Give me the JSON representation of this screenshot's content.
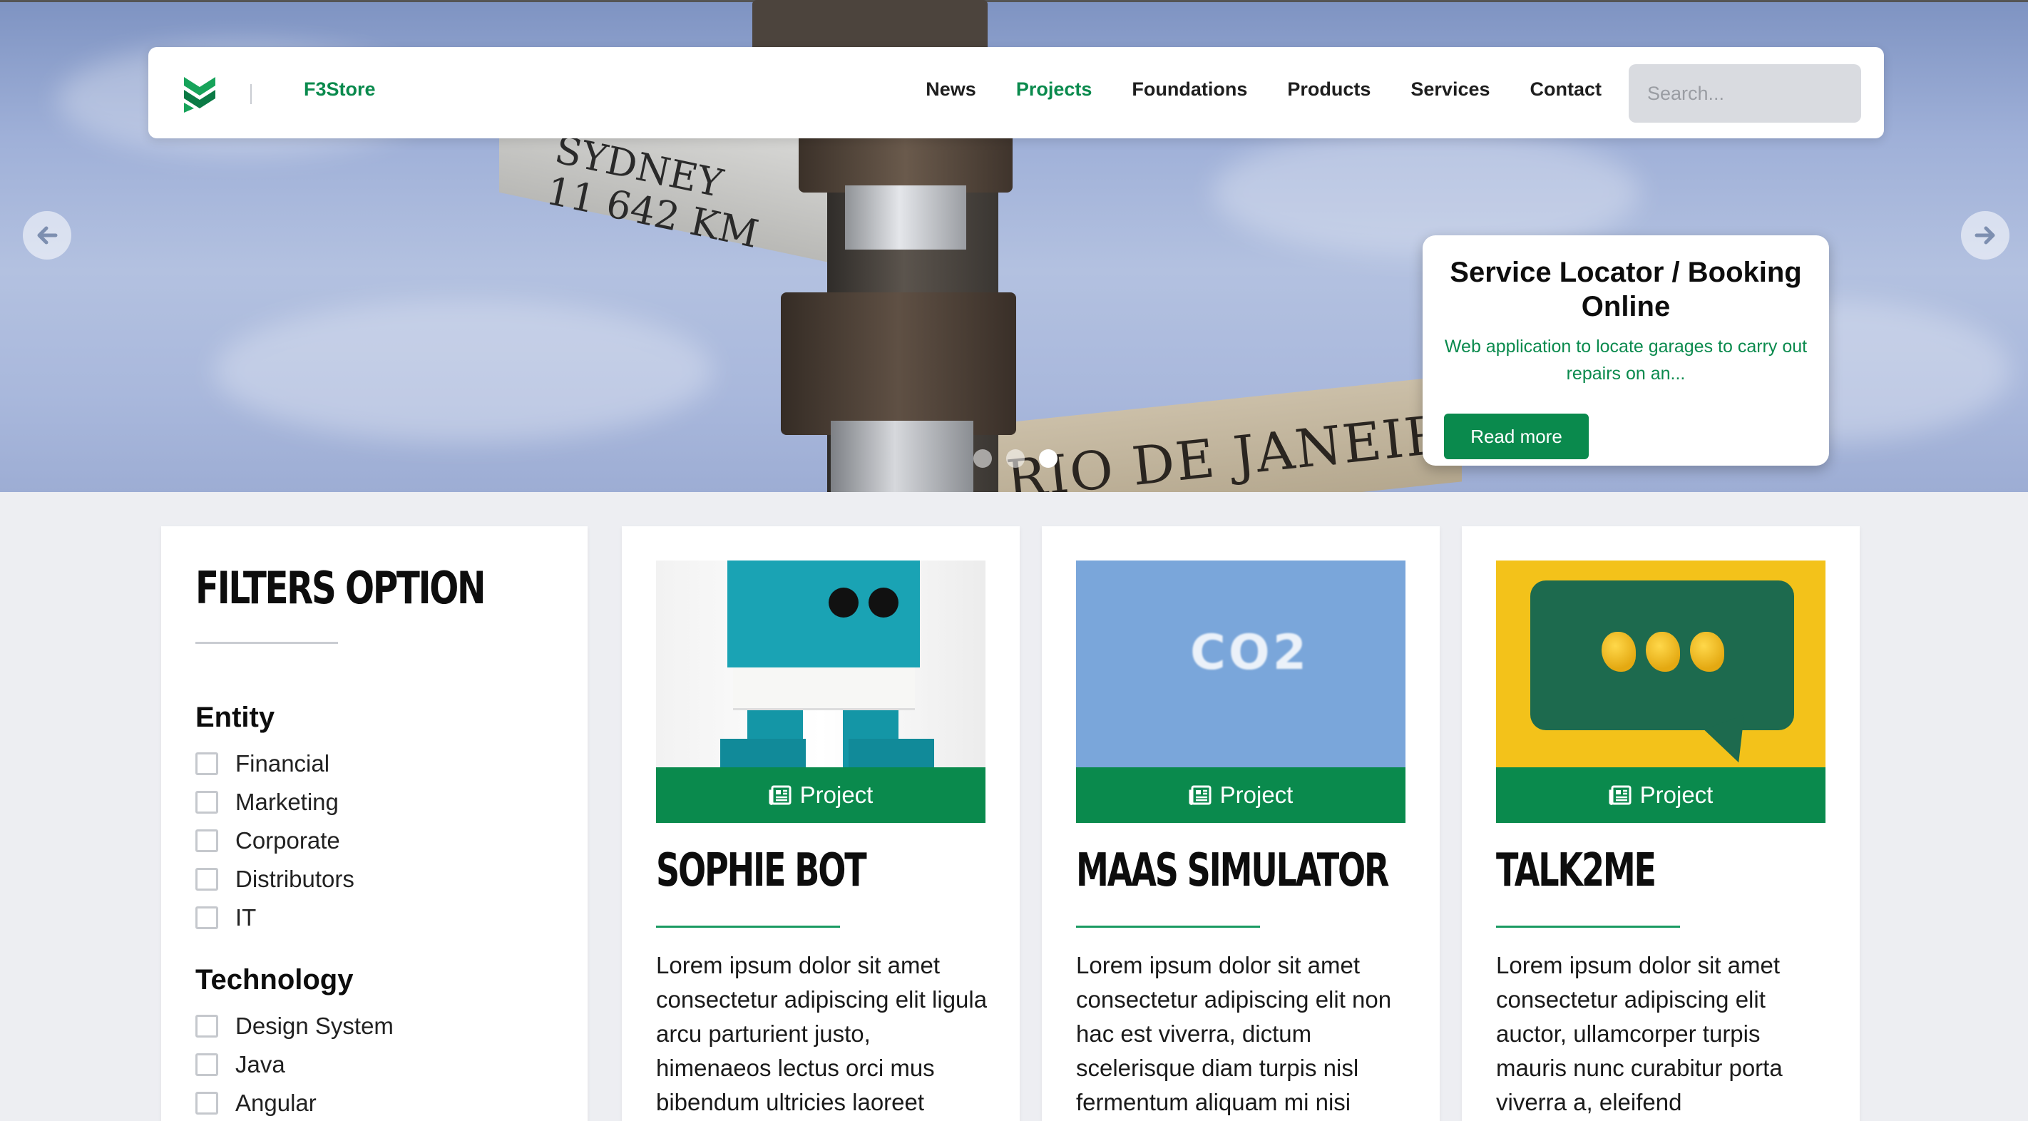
{
  "header": {
    "brand": "F3Store",
    "nav": [
      "News",
      "Projects",
      "Foundations",
      "Products",
      "Services",
      "Contact"
    ],
    "active_nav": "Projects",
    "search_placeholder": "Search..."
  },
  "hero": {
    "sign_text_1": "SYDNEY\n11 642 KM",
    "sign_text_2": "RIO DE JANEIRO",
    "slide_title": "Service Locator / Booking Online",
    "slide_description": "Web application to locate garages to carry out repairs on an...",
    "read_more_label": "Read more",
    "dots_count": 3,
    "active_dot": 3
  },
  "filters": {
    "title": "FILTERS OPTION",
    "groups": [
      {
        "title": "Entity",
        "options": [
          "Financial",
          "Marketing",
          "Corporate",
          "Distributors",
          "IT"
        ]
      },
      {
        "title": "Technology",
        "options": [
          "Design System",
          "Java",
          "Angular"
        ]
      }
    ]
  },
  "cards": [
    {
      "badge": "Project",
      "title": "SOPHIE BOT",
      "text": "Lorem ipsum dolor sit amet consectetur adipiscing elit ligula arcu parturient justo, himenaeos lectus orci mus bibendum ultricies laoreet"
    },
    {
      "badge": "Project",
      "title": "MAAS SIMULATOR",
      "text": "Lorem ipsum dolor sit amet consectetur adipiscing elit non hac est viverra, dictum scelerisque diam turpis nisl fermentum aliquam mi nisi"
    },
    {
      "badge": "Project",
      "title": "TALK2ME",
      "text": "Lorem ipsum dolor sit amet consectetur adipiscing elit auctor, ullamcorper turpis mauris nunc curabitur porta viverra a, eleifend"
    }
  ],
  "images": {
    "co2_text": "CO2"
  },
  "colors": {
    "accent": "#0a8a4d",
    "page_bg": "#edeef2",
    "search_bg": "#d9dbe0"
  },
  "icons": {
    "prev": "arrow-left-icon",
    "next": "arrow-right-icon",
    "badge": "newspaper-icon",
    "logo": "f3-logo-icon"
  }
}
